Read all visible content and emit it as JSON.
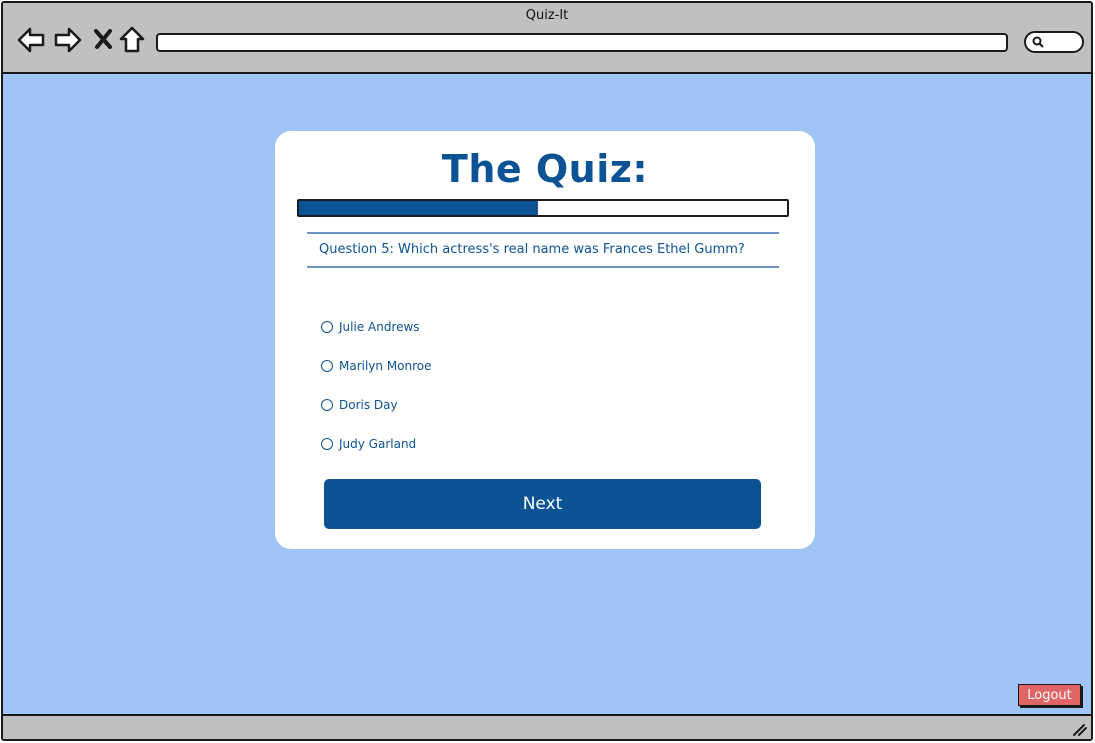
{
  "window": {
    "title": "Quiz-It"
  },
  "toolbar": {
    "url_value": ""
  },
  "quiz": {
    "title": "The Quiz:",
    "progress_fraction": 0.49,
    "question": "Question 5:  Which actress's real name was Frances Ethel Gumm?",
    "options": [
      "Julie Andrews",
      "Marilyn Monroe",
      "Doris Day",
      "Judy Garland"
    ],
    "next_label": "Next"
  },
  "footer": {
    "logout_label": "Logout"
  },
  "colors": {
    "accent": "#0b5394",
    "background": "#a1c4f7",
    "logout": "#e06666",
    "chrome": "#c0c0c0"
  },
  "icons": {
    "back": "back-arrow-icon",
    "forward": "forward-arrow-icon",
    "stop": "close-x-icon",
    "home": "home-icon",
    "search": "search-icon",
    "resize": "resize-grip-icon"
  }
}
